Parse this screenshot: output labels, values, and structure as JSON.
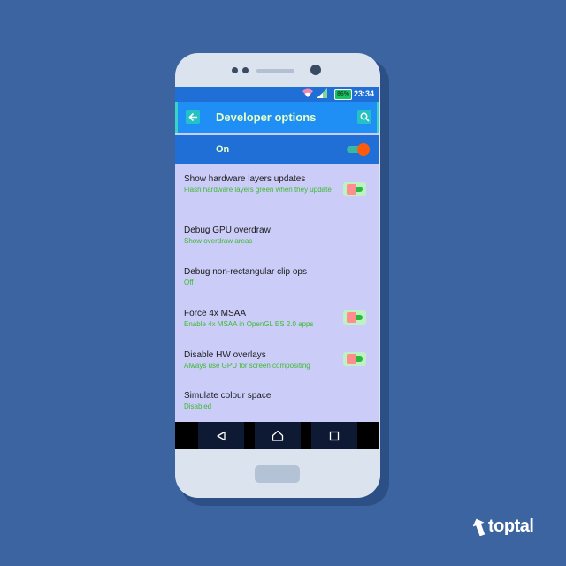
{
  "status_bar": {
    "battery": "86%",
    "time": "23:34"
  },
  "app_bar": {
    "title": "Developer options"
  },
  "master_switch": {
    "label": "On",
    "state": "on"
  },
  "settings": [
    {
      "title": "Show hardware layers updates",
      "summary": "Flash hardware layers green when they update",
      "has_toggle": true
    },
    {
      "title": "Debug GPU overdraw",
      "summary": "Show overdraw areas",
      "has_toggle": false
    },
    {
      "title": "Debug non-rectangular clip ops",
      "summary": "Off",
      "has_toggle": false
    },
    {
      "title": "Force 4x MSAA",
      "summary": "Enable 4x MSAA in OpenGL ES 2.0 apps",
      "has_toggle": true
    },
    {
      "title": "Disable HW overlays",
      "summary": "Always use GPU for screen compositing",
      "has_toggle": true
    },
    {
      "title": "Simulate colour space",
      "summary": "Disabled",
      "has_toggle": false
    }
  ],
  "nav_bar": {
    "icons": [
      "back-triangle-icon",
      "home-outline-icon",
      "recents-square-icon"
    ]
  },
  "brand": {
    "name": "toptal"
  },
  "colors": {
    "background": "#3b64a0",
    "screen": "#ccccf9",
    "status_bar": "#1f6fd6",
    "app_bar": "#1f8ff5",
    "accent": "#ff5b0c",
    "summary_text": "#3bbb2e"
  }
}
